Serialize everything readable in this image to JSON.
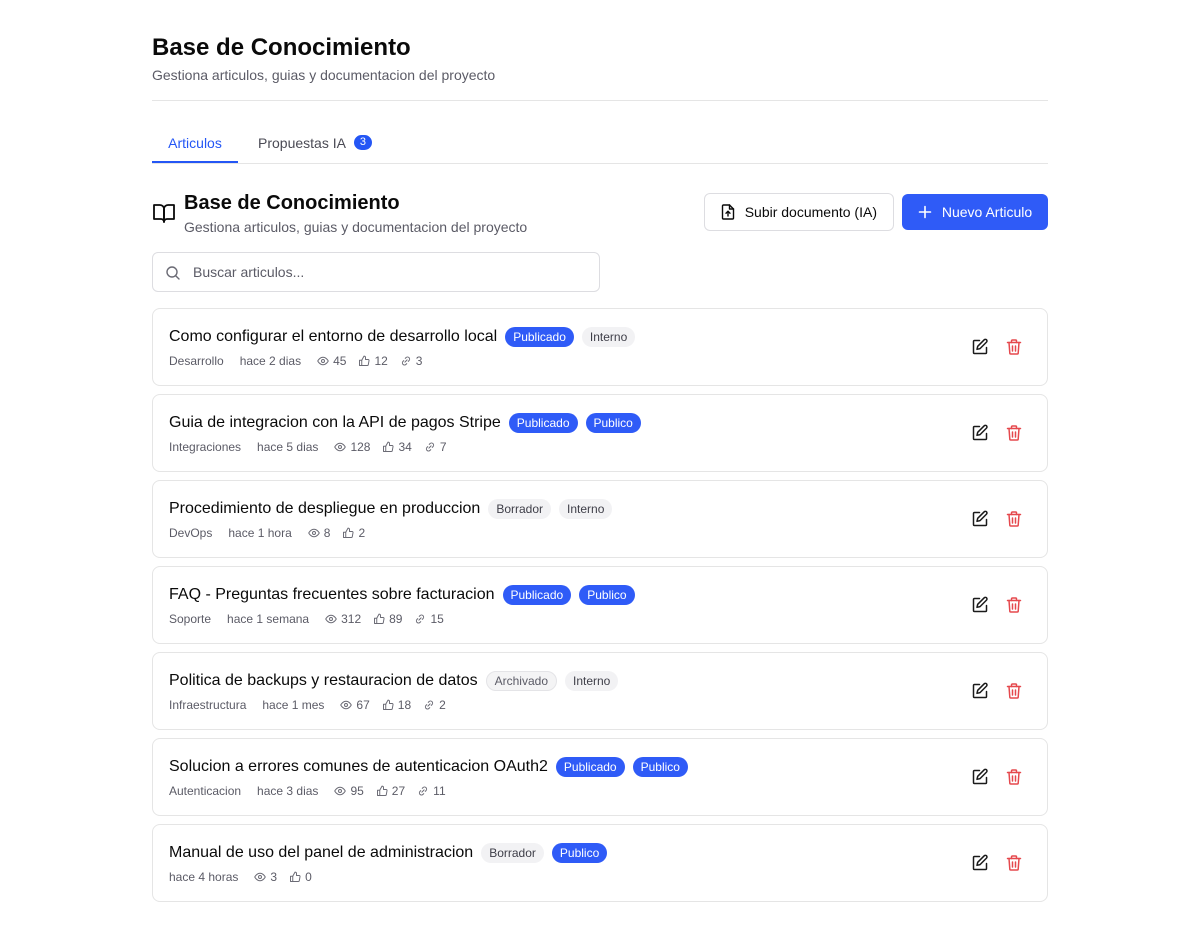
{
  "header": {
    "title": "Base de Conocimiento",
    "subtitle": "Gestiona articulos, guias y documentacion del proyecto"
  },
  "tabs": [
    {
      "label": "Articulos",
      "active": true
    },
    {
      "label": "Propuestas IA",
      "badge": "3"
    }
  ],
  "section": {
    "title": "Base de Conocimiento",
    "subtitle": "Gestiona articulos, guias y documentacion del proyecto",
    "icon": "book-open-icon"
  },
  "actions": {
    "upload_label": "Subir documento (IA)",
    "new_label": "Nuevo Articulo"
  },
  "search": {
    "placeholder": "Buscar articulos..."
  },
  "colors": {
    "accent": "#2f5bf7",
    "danger": "#e5484d",
    "border": "#e5e5e5",
    "muted_text": "#5b5b66"
  },
  "articles": [
    {
      "title": "Como configurar el entorno de desarrollo local",
      "status": "Publicado",
      "status_style": "blue",
      "visibility": "Interno",
      "visibility_style": "gray",
      "category": "Desarrollo",
      "time": "hace 2 dias",
      "views": "45",
      "likes": "12",
      "links": "3"
    },
    {
      "title": "Guia de integracion con la API de pagos Stripe",
      "status": "Publicado",
      "status_style": "blue",
      "visibility": "Publico",
      "visibility_style": "blue",
      "category": "Integraciones",
      "time": "hace 5 dias",
      "views": "128",
      "likes": "34",
      "links": "7"
    },
    {
      "title": "Procedimiento de despliegue en produccion",
      "status": "Borrador",
      "status_style": "gray",
      "visibility": "Interno",
      "visibility_style": "gray",
      "category": "DevOps",
      "time": "hace 1 hora",
      "views": "8",
      "likes": "2"
    },
    {
      "title": "FAQ - Preguntas frecuentes sobre facturacion",
      "status": "Publicado",
      "status_style": "blue",
      "visibility": "Publico",
      "visibility_style": "blue",
      "category": "Soporte",
      "time": "hace 1 semana",
      "views": "312",
      "likes": "89",
      "links": "15"
    },
    {
      "title": "Politica de backups y restauracion de datos",
      "status": "Archivado",
      "status_style": "gray-outline",
      "visibility": "Interno",
      "visibility_style": "gray",
      "category": "Infraestructura",
      "time": "hace 1 mes",
      "views": "67",
      "likes": "18",
      "links": "2"
    },
    {
      "title": "Solucion a errores comunes de autenticacion OAuth2",
      "status": "Publicado",
      "status_style": "blue",
      "visibility": "Publico",
      "visibility_style": "blue",
      "category": "Autenticacion",
      "time": "hace 3 dias",
      "views": "95",
      "likes": "27",
      "links": "11"
    },
    {
      "title": "Manual de uso del panel de administracion",
      "status": "Borrador",
      "status_style": "gray",
      "visibility": "Publico",
      "visibility_style": "blue",
      "time": "hace 4 horas",
      "views": "3",
      "likes": "0"
    }
  ]
}
